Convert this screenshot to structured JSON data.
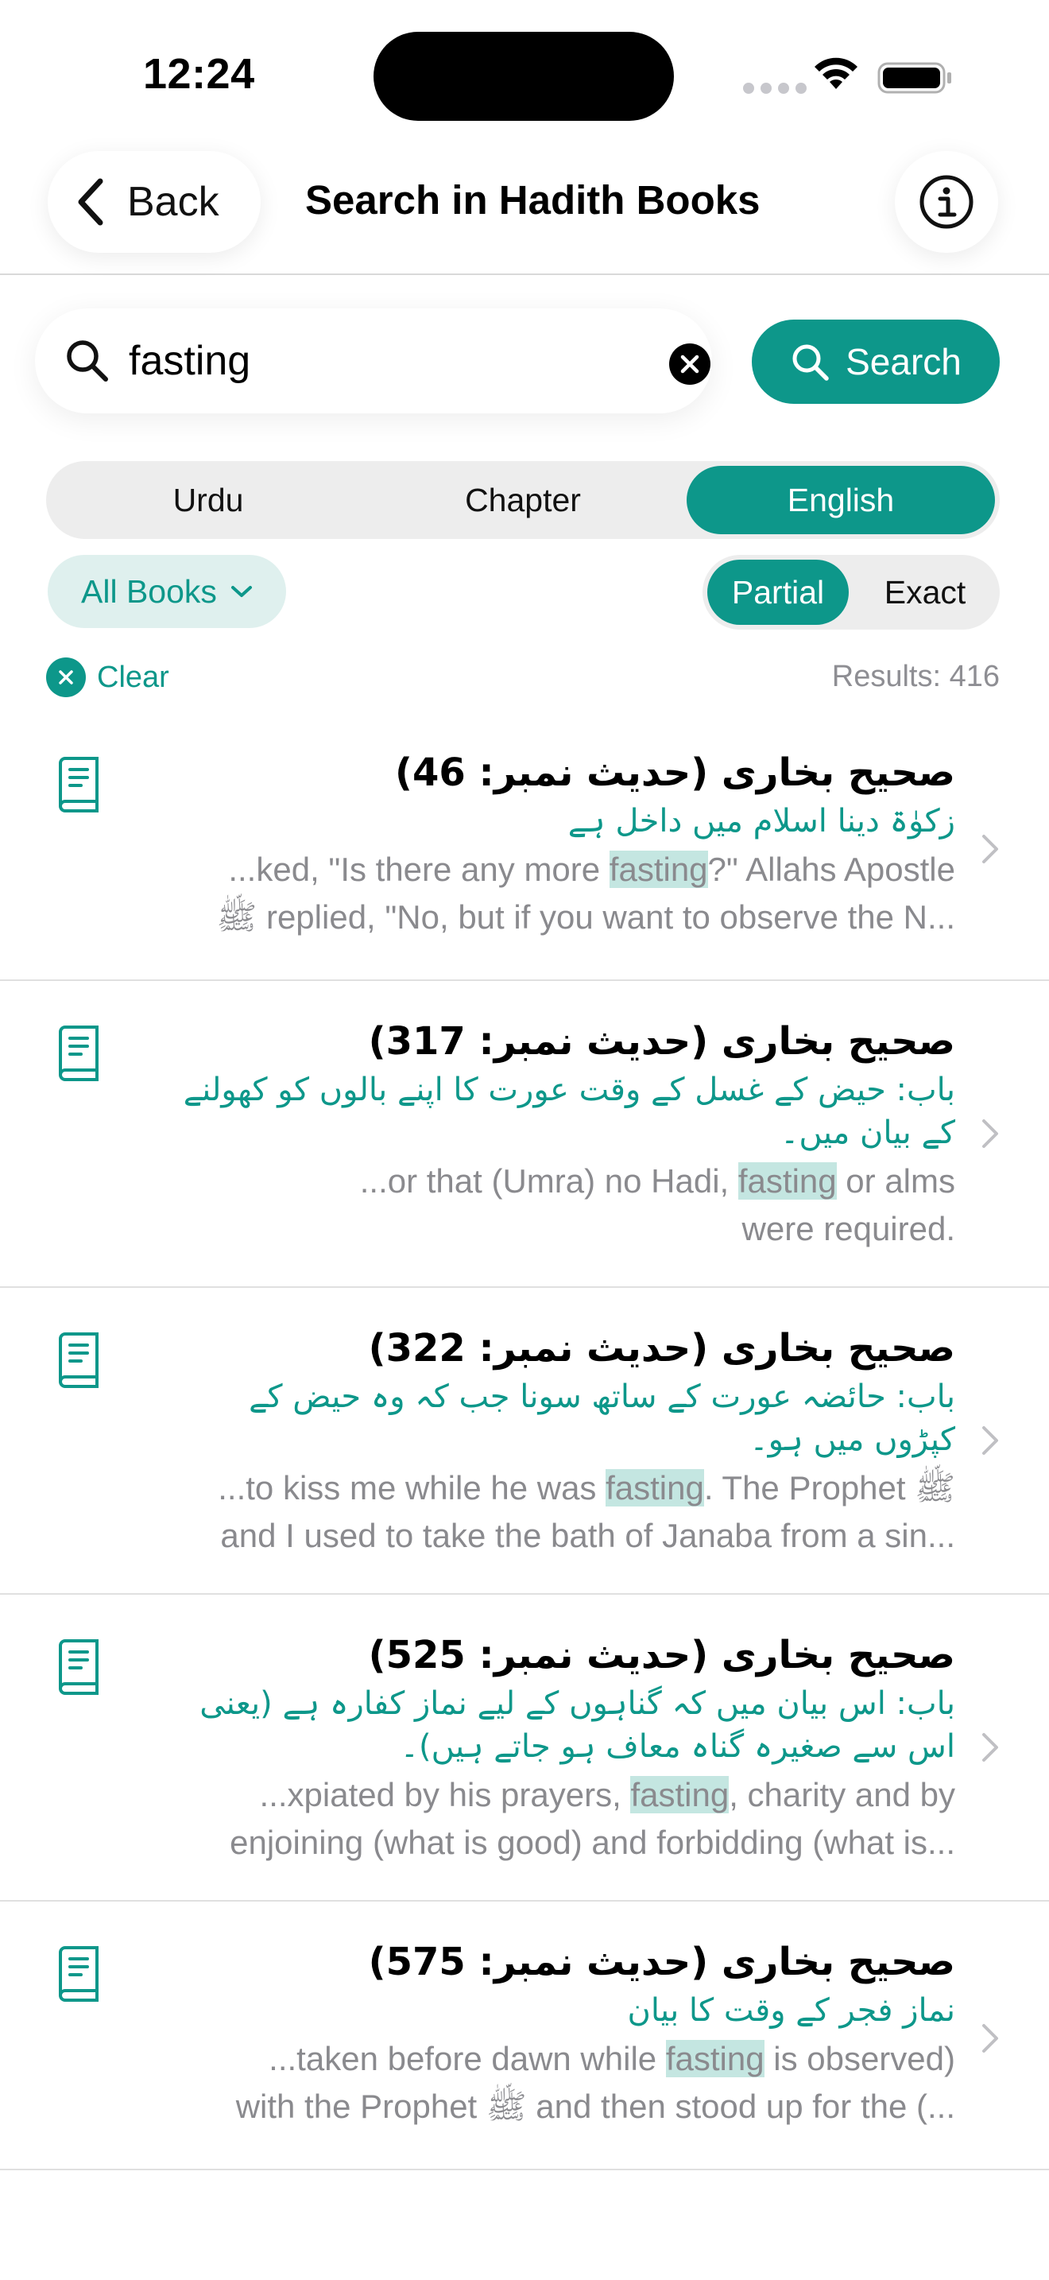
{
  "status_bar": {
    "time": "12:24"
  },
  "nav": {
    "back_label": "Back",
    "title": "Search in Hadith Books"
  },
  "search": {
    "query": "fasting",
    "button_label": "Search"
  },
  "language_tabs": [
    {
      "label": "Urdu",
      "selected": false
    },
    {
      "label": "Chapter",
      "selected": false
    },
    {
      "label": "English",
      "selected": true
    }
  ],
  "filters": {
    "books_label": "All Books",
    "match_modes": [
      {
        "label": "Partial",
        "selected": true
      },
      {
        "label": "Exact",
        "selected": false
      }
    ],
    "clear_label": "Clear",
    "results_label": "Results: 416"
  },
  "results": [
    {
      "title": "صحیح بخاری  (حدیث نمبر: 46)",
      "chapter": "زکوٰۃ دینا اسلام میں داخل ہے",
      "snippet_line1_before": "...ked, \"Is there any more ",
      "snippet_highlight": "fasting",
      "snippet_line1_after": "?\" Allahs Apostle",
      "snippet_line2": "ﷺ replied, \"No, but if you want to observe the N..."
    },
    {
      "title": "صحیح بخاری  (حدیث نمبر: 317)",
      "chapter": "باب: حیض کے غسل کے وقت عورت کا اپنے بالوں کو کھولنے کے بیان میں۔",
      "snippet_line1_before": "...or that (Umra) no Hadi, ",
      "snippet_highlight": "fasting",
      "snippet_line1_after": " or alms",
      "snippet_line2": "were required."
    },
    {
      "title": "صحیح بخاری  (حدیث نمبر: 322)",
      "chapter": "باب: حائضہ عورت کے ساتھ سونا جب کہ وہ حیض کے کپڑوں میں ہو۔",
      "snippet_line1_before": "...to kiss me while he was ",
      "snippet_highlight": "fasting",
      "snippet_line1_after": ". The Prophet ﷺ",
      "snippet_line2": "and I used to take the bath of Janaba from a sin..."
    },
    {
      "title": "صحیح بخاری  (حدیث نمبر: 525)",
      "chapter": "باب: اس بیان میں کہ گناہوں کے لیے نماز کفارہ ہے (یعنی اس سے صغیرہ گناہ معاف ہو جاتے ہیں)۔",
      "snippet_line1_before": "...xpiated by his prayers, ",
      "snippet_highlight": "fasting",
      "snippet_line1_after": ", charity and by",
      "snippet_line2": "enjoining (what is good) and forbidding (what is..."
    },
    {
      "title": "صحیح بخاری  (حدیث نمبر: 575)",
      "chapter": "نماز فجر کے وقت کا بیان",
      "snippet_line1_before": "...taken before dawn while ",
      "snippet_highlight": "fasting",
      "snippet_line1_after": " is observed)",
      "snippet_line2": "with the Prophet ﷺ and then stood up for the (..."
    }
  ],
  "colors": {
    "accent": "#0d978a",
    "accent_light": "#dff0ee",
    "highlight": "#c4e6e1"
  },
  "icons": [
    "back-chevron-icon",
    "info-icon",
    "search-icon",
    "clear-icon",
    "chevron-down-icon",
    "book-icon",
    "chevron-right-icon",
    "wifi-icon",
    "battery-icon"
  ]
}
